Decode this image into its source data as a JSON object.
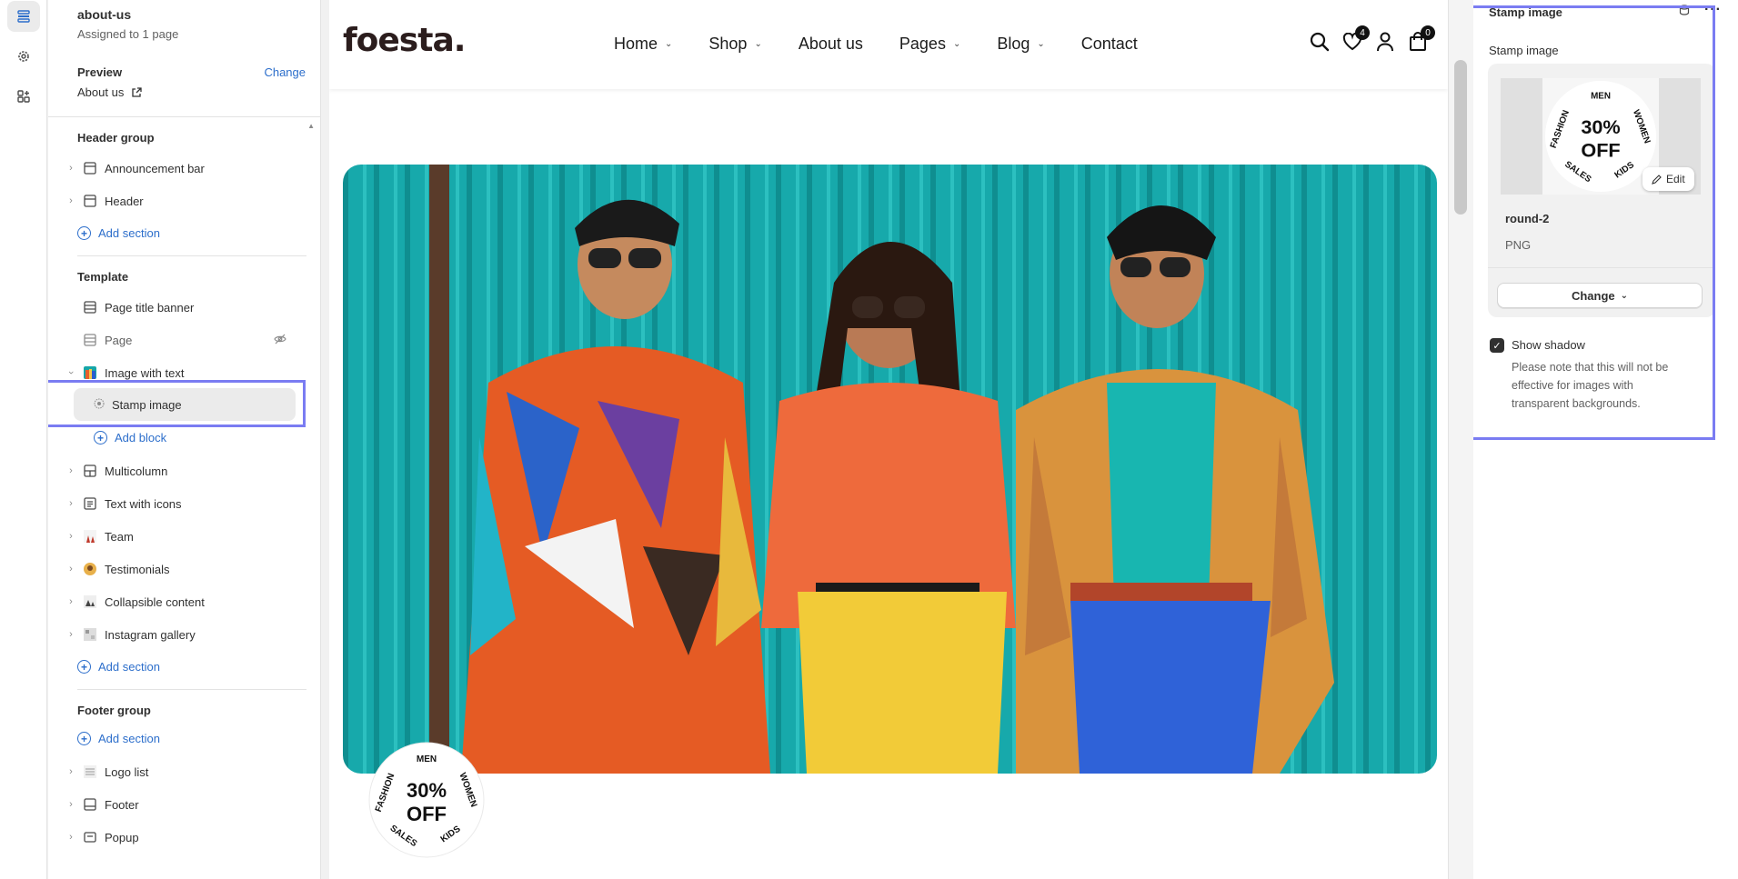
{
  "theme": {
    "accent": "#2c6ecb",
    "highlight": "#7a7cf2",
    "hero_bg": "#16a6a8"
  },
  "rail": {
    "icons": [
      "sections-icon",
      "settings-gear-icon",
      "apps-icon"
    ]
  },
  "left_panel": {
    "title": "about-us",
    "subtitle": "Assigned to 1 page",
    "preview_label": "Preview",
    "change_label": "Change",
    "preview_value": "About us",
    "header_group": {
      "label": "Header group",
      "items": [
        "Announcement bar",
        "Header"
      ],
      "add_label": "Add section"
    },
    "template": {
      "label": "Template",
      "items": [
        "Page title banner",
        "Page",
        "Image with text"
      ],
      "selected_block": "Stamp image",
      "add_block_label": "Add block",
      "more_items": [
        "Multicolumn",
        "Text with icons",
        "Team",
        "Testimonials",
        "Collapsible content",
        "Instagram gallery"
      ],
      "add_label": "Add section"
    },
    "footer_group": {
      "label": "Footer group",
      "add_label": "Add section",
      "items": [
        "Logo list",
        "Footer",
        "Popup"
      ]
    }
  },
  "storefront": {
    "logo": "foesta.",
    "nav": [
      {
        "label": "Home",
        "dropdown": true
      },
      {
        "label": "Shop",
        "dropdown": true
      },
      {
        "label": "About us",
        "dropdown": false
      },
      {
        "label": "Pages",
        "dropdown": true
      },
      {
        "label": "Blog",
        "dropdown": true
      },
      {
        "label": "Contact",
        "dropdown": false
      }
    ],
    "wishlist_count": "4",
    "cart_count": "0",
    "stamp": {
      "top": "MEN",
      "right": "WOMEN",
      "bottom_right": "KIDS",
      "bottom_left": "SALES",
      "left": "FASHION",
      "line1": "30%",
      "line2": "OFF"
    }
  },
  "right_panel": {
    "header": "Stamp image",
    "field_label": "Stamp image",
    "edit_label": "Edit",
    "file_name": "round-2",
    "file_type": "PNG",
    "change_label": "Change",
    "show_shadow_label": "Show shadow",
    "show_shadow_checked": true,
    "note": "Please note that this will not be effective for images with transparent backgrounds."
  }
}
